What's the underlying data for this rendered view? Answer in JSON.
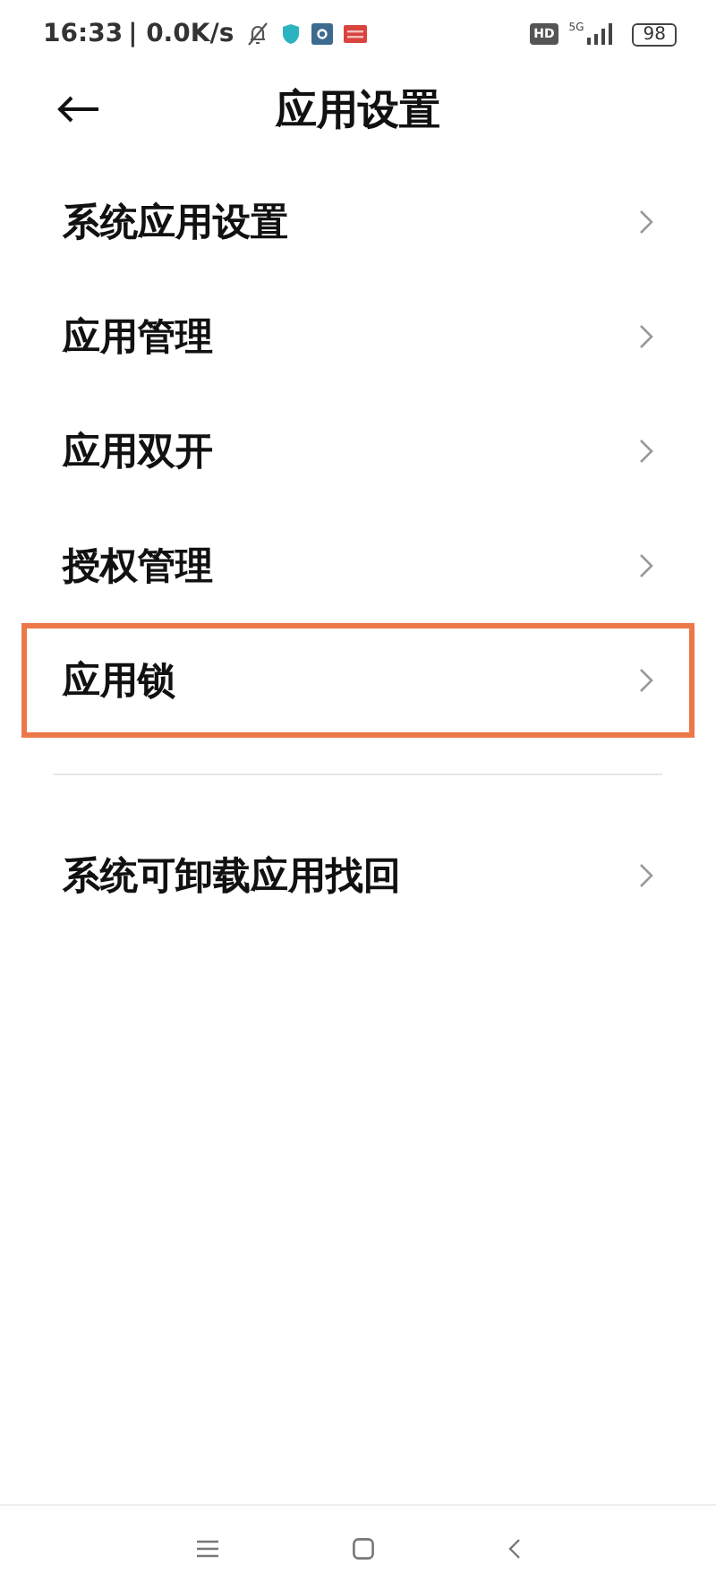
{
  "status_bar": {
    "time": "16:33",
    "speed": "| 0.0K/s",
    "hd": "HD",
    "network": "5G",
    "battery": "98"
  },
  "header": {
    "title": "应用设置"
  },
  "groups": [
    {
      "items": [
        {
          "label": "系统应用设置",
          "highlighted": false
        },
        {
          "label": "应用管理",
          "highlighted": false
        },
        {
          "label": "应用双开",
          "highlighted": false
        },
        {
          "label": "授权管理",
          "highlighted": false
        },
        {
          "label": "应用锁",
          "highlighted": true
        }
      ]
    },
    {
      "items": [
        {
          "label": "系统可卸载应用找回",
          "highlighted": false
        }
      ]
    }
  ]
}
